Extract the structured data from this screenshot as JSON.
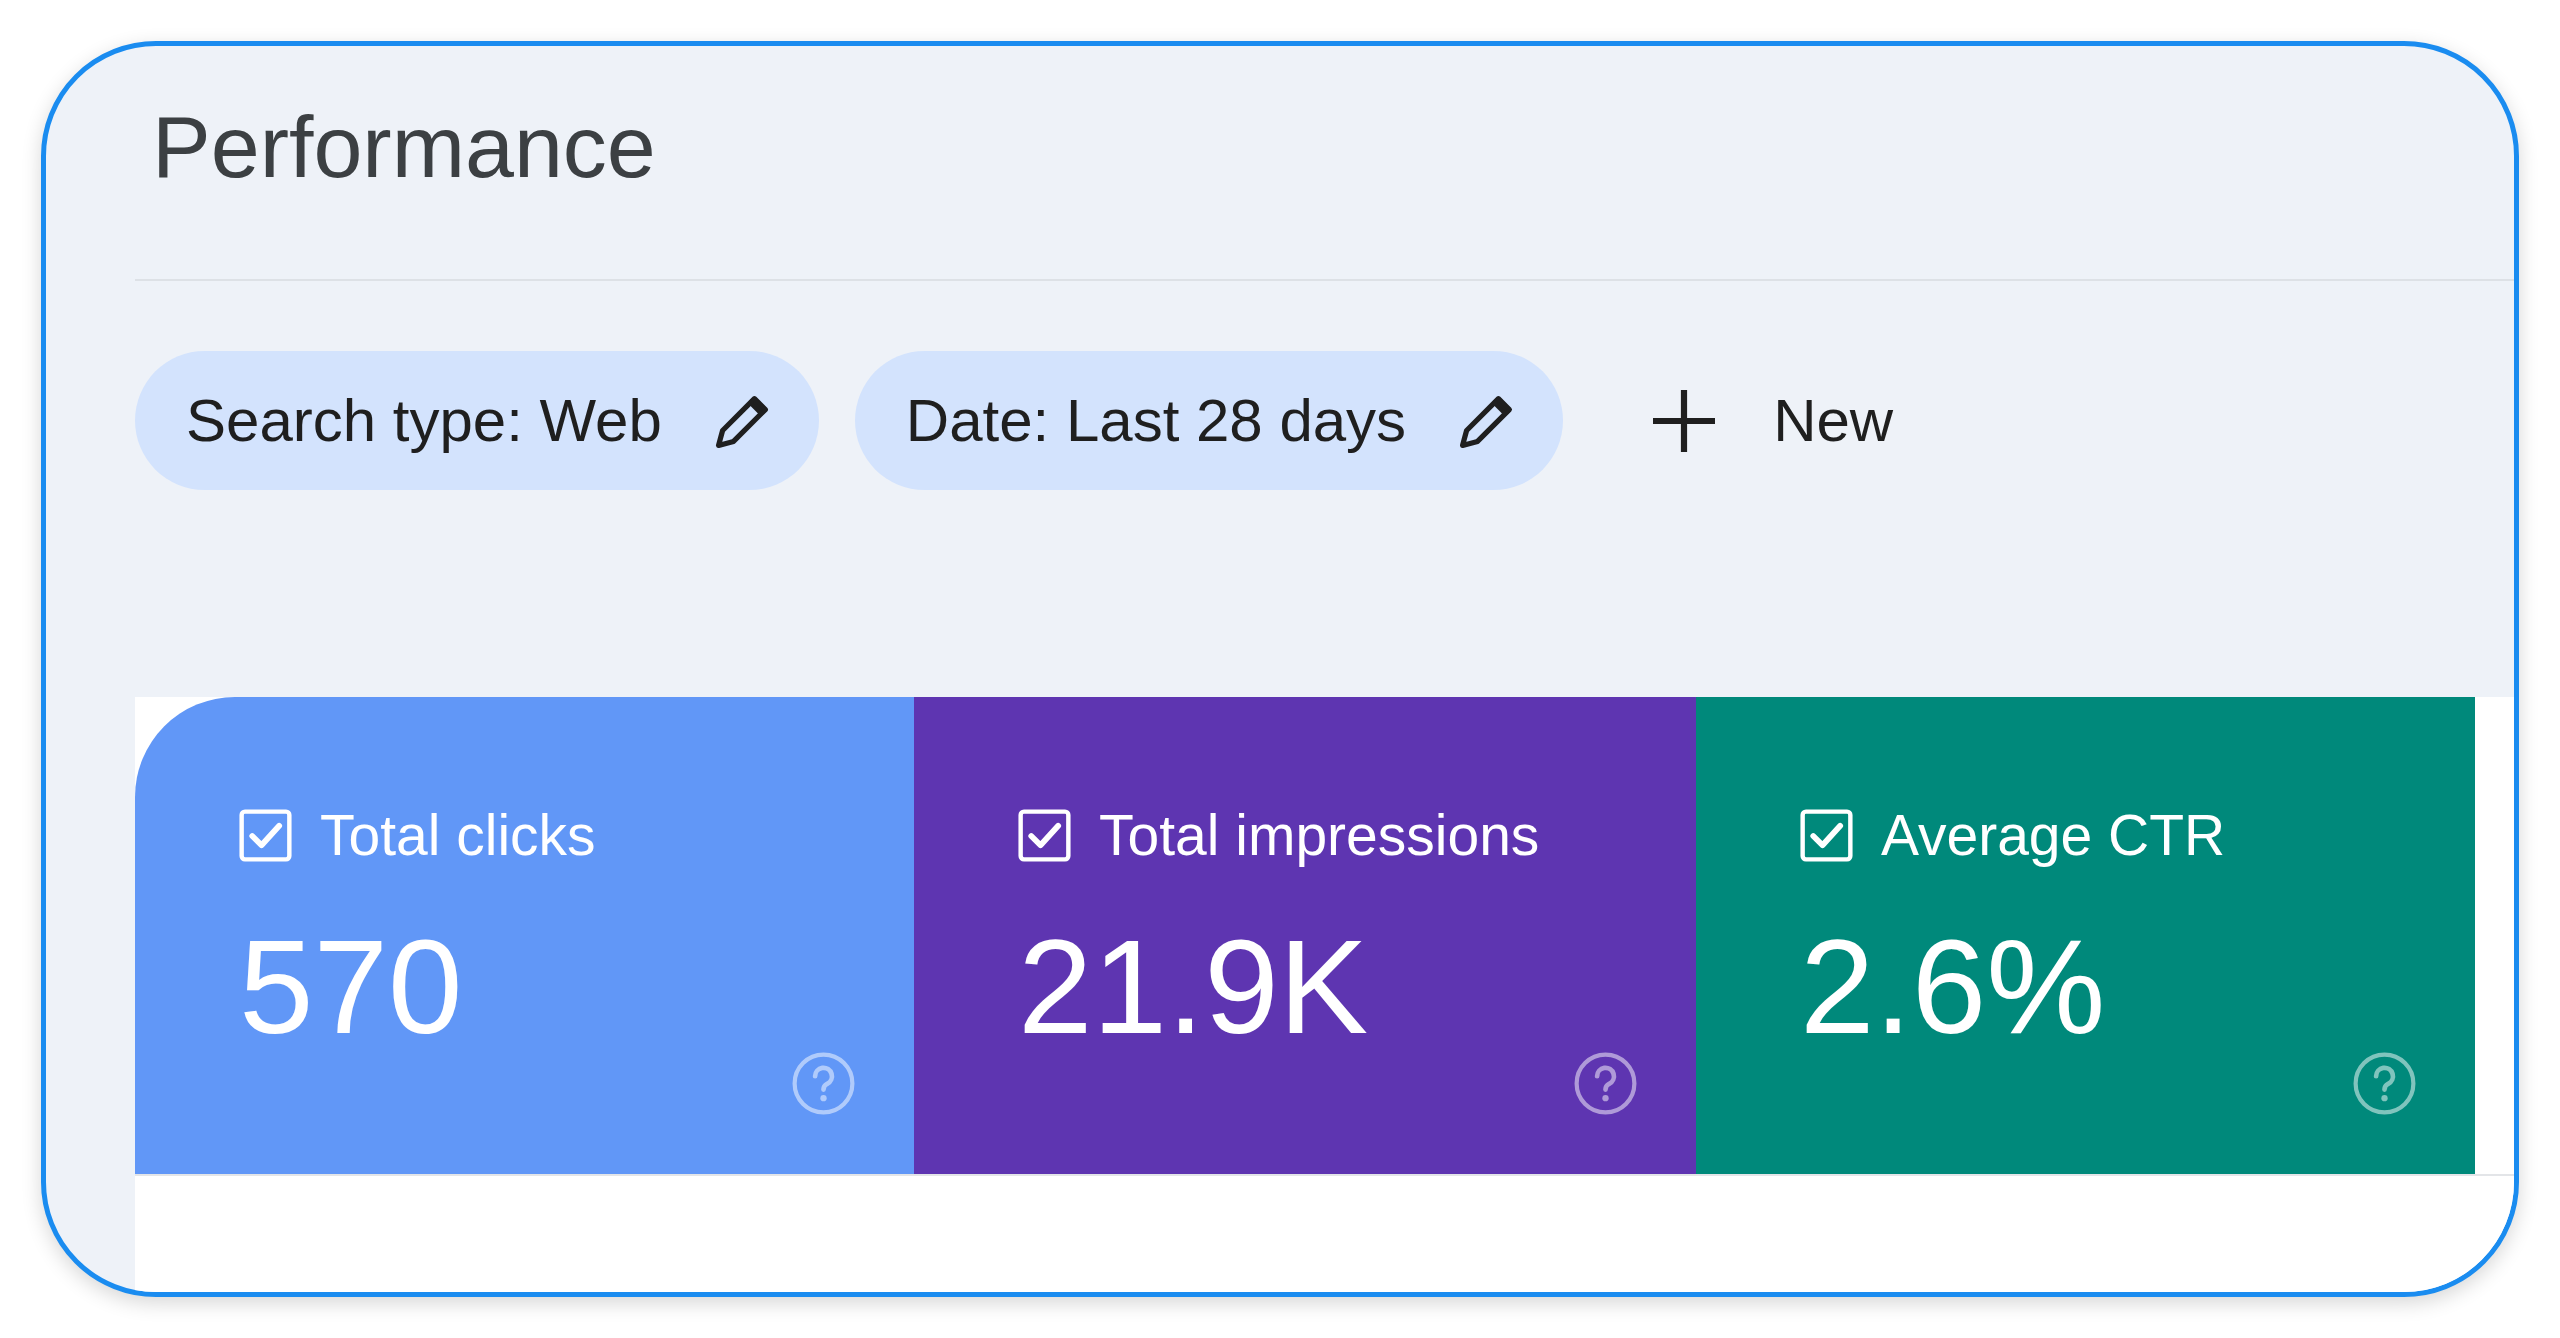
{
  "page": {
    "title": "Performance"
  },
  "filters": [
    {
      "label": "Search type: Web"
    },
    {
      "label": "Date: Last 28 days"
    }
  ],
  "new_filter": {
    "label": "New"
  },
  "metrics": [
    {
      "label": "Total clicks",
      "value": "570",
      "checked": true,
      "color": "#6197f7"
    },
    {
      "label": "Total impressions",
      "value": "21.9K",
      "checked": true,
      "color": "#5e35b1"
    },
    {
      "label": "Average CTR",
      "value": "2.6%",
      "checked": true,
      "color": "#00897b"
    }
  ]
}
